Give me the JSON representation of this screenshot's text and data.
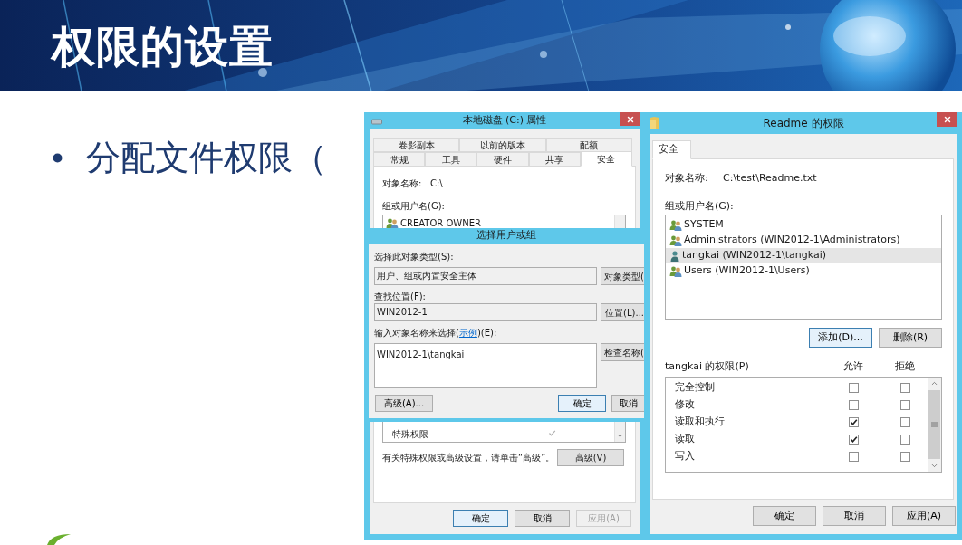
{
  "slide": {
    "title": "权限的设置",
    "bullet": "分配文件权限（"
  },
  "properties_dialog": {
    "title": "本地磁盘 (C:) 属性",
    "tab_rows": [
      [
        {
          "label": "卷影副本",
          "selected": false
        },
        {
          "label": "以前的版本",
          "selected": false
        },
        {
          "label": "配额",
          "selected": false
        }
      ],
      [
        {
          "label": "常规",
          "selected": false
        },
        {
          "label": "工具",
          "selected": false
        },
        {
          "label": "硬件",
          "selected": false
        },
        {
          "label": "共享",
          "selected": false
        },
        {
          "label": "安全",
          "selected": true
        }
      ]
    ],
    "object_label": "对象名称:",
    "object_value": "C:\\",
    "group_label": "组或用户名(G):",
    "principals": [
      {
        "name": "CREATOR OWNER",
        "kind": "group",
        "selected": false
      }
    ],
    "permissions": [
      {
        "name": "特殊权限",
        "allow": true
      }
    ],
    "advanced_note": "有关特殊权限或高级设置，请单击“高级”。",
    "advanced_button": "高级(V)",
    "buttons": [
      {
        "label": "确定",
        "default": true,
        "disabled": false
      },
      {
        "label": "取消",
        "default": false,
        "disabled": false
      },
      {
        "label": "应用(A)",
        "default": false,
        "disabled": true
      }
    ]
  },
  "select_dialog": {
    "title": "选择用户或组",
    "fields": [
      {
        "label": "选择此对象类型(S):",
        "value": "用户、组或内置安全主体",
        "button": "对象类型("
      },
      {
        "label": "查找位置(F):",
        "value": "WIN2012-1",
        "button": "位置(L)..."
      }
    ],
    "names_label_before": "输入对象名称来选择(",
    "names_link": "示例",
    "names_label_after": ")(E):",
    "names_value": "WIN2012-1\\tangkai",
    "names_button": "检查名称(",
    "buttons": [
      {
        "label": "高级(A)...",
        "default": false
      },
      {
        "label": "确定",
        "default": true
      },
      {
        "label": "取消",
        "default": false
      }
    ]
  },
  "permissions_dialog": {
    "title": "Readme 的权限",
    "tabs": [
      {
        "label": "安全",
        "selected": true
      }
    ],
    "object_label": "对象名称:",
    "object_value": "C:\\test\\Readme.txt",
    "group_label": "组或用户名(G):",
    "principals": [
      {
        "name": "SYSTEM",
        "kind": "group",
        "selected": false
      },
      {
        "name": "Administrators (WIN2012-1\\Administrators)",
        "kind": "group",
        "selected": false
      },
      {
        "name": "tangkai (WIN2012-1\\tangkai)",
        "kind": "user",
        "selected": true
      },
      {
        "name": "Users (WIN2012-1\\Users)",
        "kind": "group",
        "selected": false
      }
    ],
    "list_buttons": [
      {
        "label": "添加(D)...",
        "default": true
      },
      {
        "label": "删除(R)",
        "default": false
      }
    ],
    "permissions_label": "tangkai 的权限(P)",
    "allow_label": "允许",
    "deny_label": "拒绝",
    "permissions": [
      {
        "name": "完全控制",
        "allow": false,
        "deny": false
      },
      {
        "name": "修改",
        "allow": false,
        "deny": false
      },
      {
        "name": "读取和执行",
        "allow": true,
        "deny": false
      },
      {
        "name": "读取",
        "allow": true,
        "deny": false
      },
      {
        "name": "写入",
        "allow": false,
        "deny": false
      }
    ],
    "buttons": [
      {
        "label": "确定",
        "default": false,
        "disabled": false
      },
      {
        "label": "取消",
        "default": false,
        "disabled": false
      },
      {
        "label": "应用(A)",
        "default": false,
        "disabled": false
      }
    ]
  }
}
